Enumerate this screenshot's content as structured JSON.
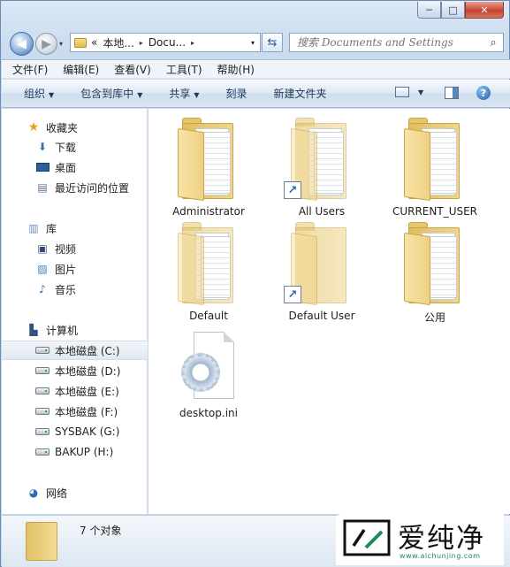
{
  "window": {
    "caption_buttons": {
      "minimize": "─",
      "maximize": "□",
      "close": "✕"
    }
  },
  "address": {
    "overflow": "«",
    "crumbs": [
      "本地...",
      "Docu..."
    ],
    "separator": "▸",
    "dropdown": "▾",
    "refresh": "⇆"
  },
  "search": {
    "placeholder": "搜索 Documents and Settings",
    "icon": "search-icon"
  },
  "menu": [
    "文件(F)",
    "编辑(E)",
    "查看(V)",
    "工具(T)",
    "帮助(H)"
  ],
  "commands": [
    {
      "label": "组织",
      "dropdown": true
    },
    {
      "label": "包含到库中",
      "dropdown": true
    },
    {
      "label": "共享",
      "dropdown": true
    },
    {
      "label": "刻录",
      "dropdown": false
    },
    {
      "label": "新建文件夹",
      "dropdown": false
    }
  ],
  "help_label": "?",
  "nav": {
    "favorites": {
      "label": "收藏夹",
      "items": [
        "下载",
        "桌面",
        "最近访问的位置"
      ]
    },
    "libraries": {
      "label": "库",
      "items": [
        "视频",
        "图片",
        "音乐"
      ]
    },
    "computer": {
      "label": "计算机",
      "drives": [
        "本地磁盘 (C:)",
        "本地磁盘 (D:)",
        "本地磁盘 (E:)",
        "本地磁盘 (F:)",
        "SYSBAK (G:)",
        "BAKUP (H:)"
      ],
      "selected": "本地磁盘 (C:)"
    },
    "network": {
      "label": "网络"
    }
  },
  "files": [
    {
      "name": "Administrator",
      "type": "folder",
      "shortcut": false
    },
    {
      "name": "All Users",
      "type": "folder",
      "shortcut": true
    },
    {
      "name": "CURRENT_USER",
      "type": "folder",
      "shortcut": false
    },
    {
      "name": "Default",
      "type": "folder",
      "shortcut": false
    },
    {
      "name": "Default User",
      "type": "folder",
      "shortcut": true
    },
    {
      "name": "公用",
      "type": "folder",
      "shortcut": false
    },
    {
      "name": "desktop.ini",
      "type": "settings-file",
      "shortcut": false
    }
  ],
  "status": {
    "count_text": "7 个对象"
  },
  "watermark": {
    "brand": "爱纯净",
    "url": "www.aichunjing.com"
  },
  "colors": {
    "accent": "#2f6bb0",
    "folder": "#e8c86d",
    "selection": "#e2e9f1",
    "watermark_green": "#1a8b55"
  }
}
